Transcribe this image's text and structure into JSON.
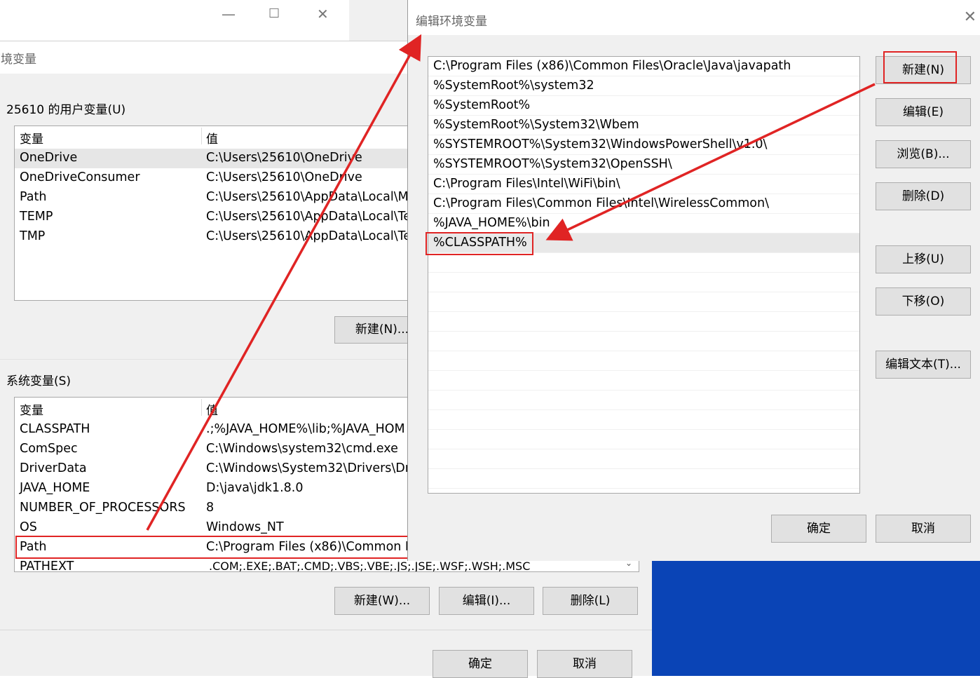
{
  "back_window": {
    "title": "环境变量",
    "user_section_label": "25610 的用户变量(U)",
    "system_section_label": "系统变量(S)",
    "col_variable": "变量",
    "col_value": "值",
    "user_vars": [
      {
        "name": "OneDrive",
        "value": "C:\\Users\\25610\\OneDrive"
      },
      {
        "name": "OneDriveConsumer",
        "value": "C:\\Users\\25610\\OneDrive"
      },
      {
        "name": "Path",
        "value": "C:\\Users\\25610\\AppData\\Local\\M"
      },
      {
        "name": "TEMP",
        "value": "C:\\Users\\25610\\AppData\\Local\\Te"
      },
      {
        "name": "TMP",
        "value": "C:\\Users\\25610\\AppData\\Local\\Te"
      }
    ],
    "user_new_button": "新建(N)...",
    "system_vars": [
      {
        "name": "CLASSPATH",
        "value": ".;%JAVA_HOME%\\lib;%JAVA_HOM"
      },
      {
        "name": "ComSpec",
        "value": "C:\\Windows\\system32\\cmd.exe"
      },
      {
        "name": "DriverData",
        "value": "C:\\Windows\\System32\\Drivers\\Dr"
      },
      {
        "name": "JAVA_HOME",
        "value": "D:\\java\\jdk1.8.0"
      },
      {
        "name": "NUMBER_OF_PROCESSORS",
        "value": "8"
      },
      {
        "name": "OS",
        "value": "Windows_NT"
      },
      {
        "name": "Path",
        "value": "C:\\Program Files (x86)\\Common F"
      },
      {
        "name": "PATHEXT",
        "value": ".COM;.EXE;.BAT;.CMD;.VBS;.VBE;.JS;.JSE;.WSF;.WSH;.MSC"
      }
    ],
    "system_new_button": "新建(W)...",
    "system_edit_button": "编辑(I)...",
    "system_delete_button": "删除(L)",
    "ok_button": "确定",
    "cancel_button": "取消"
  },
  "edit_dialog": {
    "title": "编辑环境变量",
    "paths": [
      "C:\\Program Files (x86)\\Common Files\\Oracle\\Java\\javapath",
      "%SystemRoot%\\system32",
      "%SystemRoot%",
      "%SystemRoot%\\System32\\Wbem",
      "%SYSTEMROOT%\\System32\\WindowsPowerShell\\v1.0\\",
      "%SYSTEMROOT%\\System32\\OpenSSH\\",
      "C:\\Program Files\\Intel\\WiFi\\bin\\",
      "C:\\Program Files\\Common Files\\Intel\\WirelessCommon\\",
      "%JAVA_HOME%\\bin",
      "%CLASSPATH%"
    ],
    "buttons": {
      "new": "新建(N)",
      "edit": "编辑(E)",
      "browse": "浏览(B)...",
      "delete": "删除(D)",
      "move_up": "上移(U)",
      "move_down": "下移(O)",
      "edit_text": "编辑文本(T)...",
      "ok": "确定",
      "cancel": "取消"
    }
  },
  "colors": {
    "annotation": "#e02424",
    "desktop": "#0b4fc4"
  },
  "icons": [
    "minimize-icon",
    "maximize-icon",
    "close-icon",
    "scroll-down-icon"
  ]
}
